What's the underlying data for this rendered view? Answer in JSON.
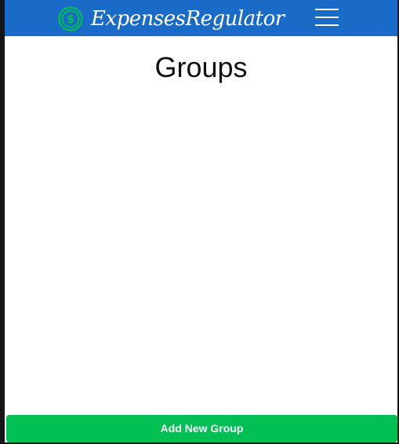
{
  "navbar": {
    "brand_text": "ExpensesRegulator",
    "logo_icon": "dollar-coin-icon",
    "menu_icon": "hamburger-menu-icon",
    "colors": {
      "background": "#1a6bc8",
      "logo": "#00c054",
      "text": "#ffffff"
    }
  },
  "main": {
    "title": "Groups"
  },
  "footer": {
    "add_button_label": "Add New Group",
    "button_color": "#00c054"
  }
}
